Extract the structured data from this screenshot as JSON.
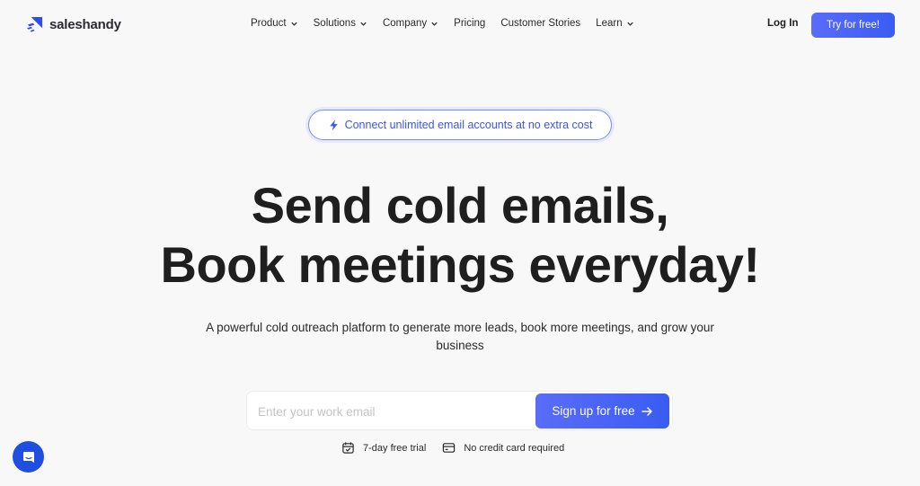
{
  "brand": {
    "name": "saleshandy",
    "accent": "#3a5cf3"
  },
  "nav": {
    "items": [
      {
        "label": "Product",
        "has_dropdown": true
      },
      {
        "label": "Solutions",
        "has_dropdown": true
      },
      {
        "label": "Company",
        "has_dropdown": true
      },
      {
        "label": "Pricing",
        "has_dropdown": false
      },
      {
        "label": "Customer Stories",
        "has_dropdown": false
      },
      {
        "label": "Learn",
        "has_dropdown": true
      }
    ],
    "login_label": "Log In",
    "cta_label": "Try for free!"
  },
  "hero": {
    "badge": {
      "icon": "lightning-icon",
      "text": "Connect unlimited email accounts at no extra cost"
    },
    "headline_line1": "Send cold emails,",
    "headline_line2": "Book meetings everyday!",
    "subtitle": "A powerful cold outreach platform to generate more leads, book more meetings, and grow your business",
    "form": {
      "email_placeholder": "Enter your work email",
      "email_value": "",
      "submit_label": "Sign up for free",
      "submit_icon": "arrow-right-icon"
    },
    "perks": [
      {
        "icon": "calendar-check-icon",
        "label": "7-day free trial"
      },
      {
        "icon": "credit-card-icon",
        "label": "No credit card required"
      }
    ]
  },
  "chat_widget": {
    "icon": "chat-icon"
  }
}
